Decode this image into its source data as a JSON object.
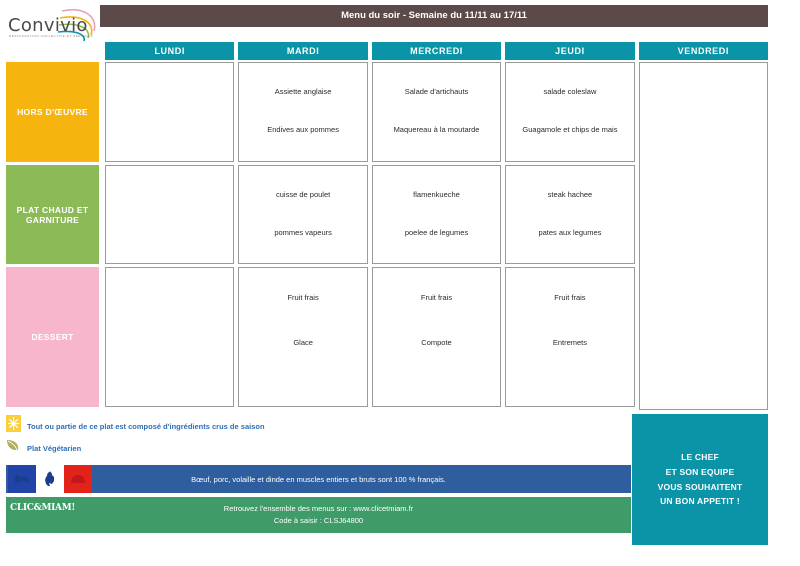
{
  "brand": {
    "logo_name": "Convivio",
    "logo_tagline": "RESTAURATION COLLECTIVE ET SERVICES"
  },
  "header": {
    "banner_title": "Menu du soir - Semaine du 11/11 au 17/11"
  },
  "table": {
    "days": [
      "LUNDI",
      "MARDI",
      "MERCREDI",
      "JEUDI",
      "VENDREDI"
    ],
    "categories": [
      "HORS D'ŒUVRE",
      "PLAT CHAUD ET GARNITURE",
      "DESSERT"
    ],
    "menu": {
      "hors_doeuvre": [
        {
          "day": "LUNDI",
          "items": [
            "",
            ""
          ]
        },
        {
          "day": "MARDI",
          "items": [
            "Assiette anglaise",
            "Endives aux pommes"
          ]
        },
        {
          "day": "MERCREDI",
          "items": [
            "Salade d'artichauts",
            "Maquereau à la moutarde"
          ]
        },
        {
          "day": "JEUDI",
          "items": [
            "salade coleslaw",
            "Guagamole et chips de mais"
          ]
        },
        {
          "day": "VENDREDI",
          "items": [
            "",
            ""
          ]
        }
      ],
      "plat_chaud": [
        {
          "day": "LUNDI",
          "items": [
            "",
            ""
          ]
        },
        {
          "day": "MARDI",
          "items": [
            "cuisse de poulet",
            "pommes vapeurs"
          ]
        },
        {
          "day": "MERCREDI",
          "items": [
            "flamenkueche",
            "poelee de legumes"
          ]
        },
        {
          "day": "JEUDI",
          "items": [
            "steak hachee",
            "pates aux legumes"
          ]
        },
        {
          "day": "VENDREDI",
          "items": [
            "",
            ""
          ]
        }
      ],
      "dessert": [
        {
          "day": "LUNDI",
          "items": [
            "",
            ""
          ]
        },
        {
          "day": "MARDI",
          "items": [
            "Fruit frais",
            "Glace"
          ]
        },
        {
          "day": "MERCREDI",
          "items": [
            "Fruit frais",
            "Compote"
          ]
        },
        {
          "day": "JEUDI",
          "items": [
            "Fruit frais",
            "Entremets"
          ]
        },
        {
          "day": "VENDREDI",
          "items": [
            "",
            ""
          ]
        }
      ]
    }
  },
  "legend": {
    "raw_seasonal": "Tout ou partie de ce plat est composé d'ingrédients crus de saison",
    "vegetarian": "Plat Végétarien"
  },
  "origin_bar": {
    "text": "Bœuf, porc, volaille et dinde en muscles entiers et bruts sont 100 % français."
  },
  "footer": {
    "logo": "CLIC&MIAM!",
    "line1": "Retrouvez l'ensemble des menus sur : www.clicetmiam.fr",
    "line2": "Code à saisir : CLSJ64800"
  },
  "chef_box": {
    "line1": "LE CHEF",
    "line2": "ET SON EQUIPE",
    "line3": "VOUS SOUHAITENT",
    "line4": "UN BON APPETIT !"
  },
  "colors": {
    "teal": "#0b93a8",
    "banner_brown": "#5b4a49",
    "amber": "#f6b40e",
    "green": "#8cba56",
    "pink": "#f7b6cb",
    "blue_bar": "#2e5e9e",
    "green_bar": "#3f9b68",
    "legend_text": "#2f6fb5"
  }
}
